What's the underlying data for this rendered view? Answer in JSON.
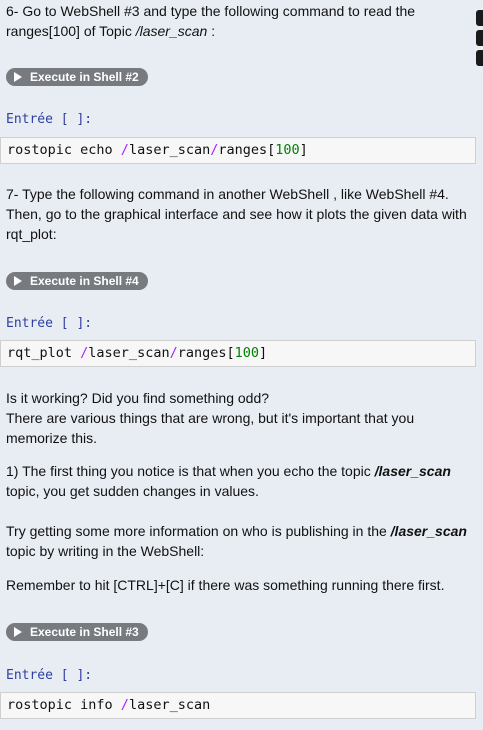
{
  "step6": {
    "line1": "6- Go to WebShell #3 and type the following command to read the",
    "line2_prefix": "ranges[100] of Topic ",
    "line2_topic": "/laser_scan",
    "line2_suffix": " :"
  },
  "buttons": {
    "exec2": "Execute in Shell #2",
    "exec4": "Execute in Shell #4",
    "exec3": "Execute in Shell #3"
  },
  "prompt": "Entrée [ ]:",
  "cell1": {
    "a": "rostopic echo ",
    "b": "/",
    "c": "laser_scan",
    "d": "/",
    "e": "ranges[",
    "f": "100",
    "g": "]"
  },
  "step7": {
    "line1": "7- Type the following command in another WebShell , like WebShell #4.",
    "line2": "Then, go to the graphical interface and see how it plots the given data with",
    "line3": "rqt_plot:"
  },
  "cell2": {
    "a": "rqt_plot ",
    "b": "/",
    "c": "laser_scan",
    "d": "/",
    "e": "ranges[",
    "f": "100",
    "g": "]"
  },
  "working": {
    "line1": "Is it working? Did you find something odd?",
    "line2": "There are various things that are wrong, but it's important that you",
    "line3": "memorize this."
  },
  "first": {
    "prefix": "1) The first thing you notice is that when you echo the topic ",
    "topic": "/laser_scan",
    "line2": "topic, you get sudden changes in values."
  },
  "try": {
    "prefix": "Try getting some more information on who is publishing in the ",
    "topic": "/laser_scan",
    "line2": "topic by writing in the WebShell:"
  },
  "remember": "Remember to hit [CTRL]+[C] if there was something running there first.",
  "cell3": {
    "a": "rostopic info ",
    "b": "/",
    "c": "laser_scan"
  }
}
